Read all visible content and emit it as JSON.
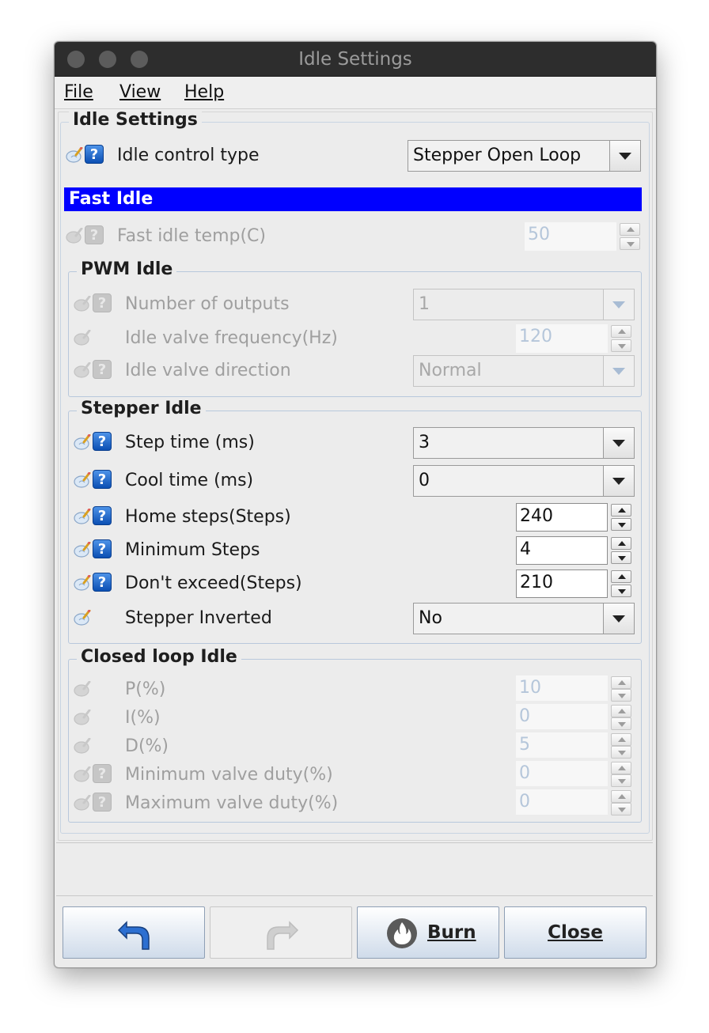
{
  "window": {
    "title": "Idle Settings"
  },
  "menu": [
    {
      "label": "File"
    },
    {
      "label": "View"
    },
    {
      "label": "Help"
    }
  ],
  "settings_group": {
    "title": "Idle Settings",
    "idle_control_type": {
      "label": "Idle control type",
      "value": "Stepper Open Loop"
    }
  },
  "fast_idle": {
    "header": "Fast Idle",
    "fast_idle_temp": {
      "label": "Fast idle temp(C)",
      "value": "50"
    }
  },
  "pwm_idle": {
    "title": "PWM Idle",
    "number_of_outputs": {
      "label": "Number of outputs",
      "value": "1"
    },
    "idle_valve_frequency": {
      "label": "Idle valve frequency(Hz)",
      "value": "120"
    },
    "idle_valve_direction": {
      "label": "Idle valve direction",
      "value": "Normal"
    }
  },
  "stepper_idle": {
    "title": "Stepper Idle",
    "step_time": {
      "label": "Step time (ms)",
      "value": "3"
    },
    "cool_time": {
      "label": "Cool time (ms)",
      "value": "0"
    },
    "home_steps": {
      "label": "Home steps(Steps)",
      "value": "240"
    },
    "minimum_steps": {
      "label": "Minimum Steps",
      "value": "4"
    },
    "dont_exceed": {
      "label": "Don't exceed(Steps)",
      "value": "210"
    },
    "stepper_inverted": {
      "label": "Stepper Inverted",
      "value": "No"
    }
  },
  "closed_loop_idle": {
    "title": "Closed loop Idle",
    "p": {
      "label": "P(%)",
      "value": "10"
    },
    "i": {
      "label": "I(%)",
      "value": "0"
    },
    "d": {
      "label": "D(%)",
      "value": "5"
    },
    "min_valve_duty": {
      "label": "Minimum valve duty(%)",
      "value": "0"
    },
    "max_valve_duty": {
      "label": "Maximum valve duty(%)",
      "value": "0"
    }
  },
  "buttons": {
    "undo_icon": "undo-arrow-icon",
    "redo_icon": "redo-arrow-icon",
    "burn": {
      "label": "Burn",
      "icon": "flame-icon"
    },
    "close": {
      "label": "Close"
    }
  },
  "colors": {
    "section_header": "#0000ff",
    "help_icon": "#0b4fb3",
    "group_border": "#b8c8dc"
  }
}
